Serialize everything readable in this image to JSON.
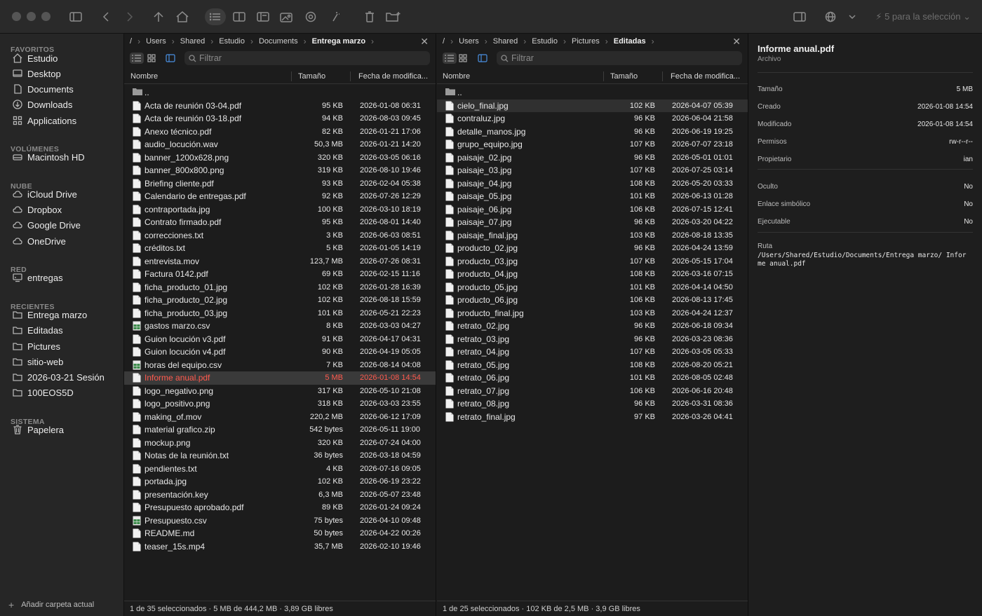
{
  "toolbar": {
    "selection_label": "5 para la selección"
  },
  "sidebar": {
    "sections": [
      {
        "title": "FAVORITOS",
        "items": [
          {
            "label": "Estudio",
            "icon": "home-icon"
          },
          {
            "label": "Desktop",
            "icon": "desktop-icon"
          },
          {
            "label": "Documents",
            "icon": "document-icon"
          },
          {
            "label": "Downloads",
            "icon": "download-icon"
          },
          {
            "label": "Applications",
            "icon": "apps-icon"
          }
        ]
      },
      {
        "title": "VOLÚMENES",
        "items": [
          {
            "label": "Macintosh HD",
            "icon": "drive-icon"
          }
        ]
      },
      {
        "title": "NUBE",
        "items": [
          {
            "label": "iCloud Drive",
            "icon": "cloud-icon"
          },
          {
            "label": "Dropbox",
            "icon": "cloud-icon"
          },
          {
            "label": "Google Drive",
            "icon": "cloud-icon"
          },
          {
            "label": "OneDrive",
            "icon": "cloud-icon"
          }
        ]
      },
      {
        "title": "RED",
        "items": [
          {
            "label": "entregas",
            "icon": "network-drive-icon"
          }
        ]
      },
      {
        "title": "RECIENTES",
        "items": [
          {
            "label": "Entrega marzo",
            "icon": "folder-icon"
          },
          {
            "label": "Editadas",
            "icon": "folder-icon"
          },
          {
            "label": "Pictures",
            "icon": "folder-icon"
          },
          {
            "label": "sitio-web",
            "icon": "folder-icon"
          },
          {
            "label": "2026-03-21 Sesión",
            "icon": "folder-icon"
          },
          {
            "label": "100EOS5D",
            "icon": "folder-icon"
          }
        ]
      },
      {
        "title": "SISTEMA",
        "items": [
          {
            "label": "Papelera",
            "icon": "trash-icon"
          }
        ]
      }
    ],
    "footer_label": "Añadir carpeta actual"
  },
  "left_pane": {
    "breadcrumb": [
      "/",
      "Users",
      "Shared",
      "Estudio",
      "Documents",
      "Entrega marzo"
    ],
    "filter_placeholder": "Filtrar",
    "columns": {
      "name": "Nombre",
      "size": "Tamaño",
      "date": "Fecha de modifica..."
    },
    "parent": "..",
    "files": [
      {
        "name": "Acta de reunión 03-04.pdf",
        "size": "95 KB",
        "date": "2026-01-08 06:31"
      },
      {
        "name": "Acta de reunión 03-18.pdf",
        "size": "94 KB",
        "date": "2026-08-03 09:45"
      },
      {
        "name": "Anexo técnico.pdf",
        "size": "82 KB",
        "date": "2026-01-21 17:06"
      },
      {
        "name": "audio_locución.wav",
        "size": "50,3 MB",
        "date": "2026-01-21 14:20"
      },
      {
        "name": "banner_1200x628.png",
        "size": "320 KB",
        "date": "2026-03-05 06:16"
      },
      {
        "name": "banner_800x800.png",
        "size": "319 KB",
        "date": "2026-08-10 19:46"
      },
      {
        "name": "Briefing cliente.pdf",
        "size": "93 KB",
        "date": "2026-02-04 05:38"
      },
      {
        "name": "Calendario de entregas.pdf",
        "size": "92 KB",
        "date": "2026-07-26 12:29"
      },
      {
        "name": "contraportada.jpg",
        "size": "100 KB",
        "date": "2026-03-10 18:19"
      },
      {
        "name": "Contrato firmado.pdf",
        "size": "95 KB",
        "date": "2026-08-01 14:40"
      },
      {
        "name": "correcciones.txt",
        "size": "3 KB",
        "date": "2026-06-03 08:51"
      },
      {
        "name": "créditos.txt",
        "size": "5 KB",
        "date": "2026-01-05 14:19"
      },
      {
        "name": "entrevista.mov",
        "size": "123,7 MB",
        "date": "2026-07-26 08:31"
      },
      {
        "name": "Factura 0142.pdf",
        "size": "69 KB",
        "date": "2026-02-15 11:16"
      },
      {
        "name": "ficha_producto_01.jpg",
        "size": "102 KB",
        "date": "2026-01-28 16:39"
      },
      {
        "name": "ficha_producto_02.jpg",
        "size": "102 KB",
        "date": "2026-08-18 15:59"
      },
      {
        "name": "ficha_producto_03.jpg",
        "size": "101 KB",
        "date": "2026-05-21 22:23"
      },
      {
        "name": "gastos marzo.csv",
        "size": "8 KB",
        "date": "2026-03-03 04:27",
        "icon": "spreadsheet-icon"
      },
      {
        "name": "Guion locución v3.pdf",
        "size": "91 KB",
        "date": "2026-04-17 04:31"
      },
      {
        "name": "Guion locución v4.pdf",
        "size": "90 KB",
        "date": "2026-04-19 05:05"
      },
      {
        "name": "horas del equipo.csv",
        "size": "7 KB",
        "date": "2026-08-14 04:08",
        "icon": "spreadsheet-icon"
      },
      {
        "name": "Informe anual.pdf",
        "size": "5 MB",
        "date": "2026-01-08 14:54",
        "highlight": true
      },
      {
        "name": "logo_negativo.png",
        "size": "317 KB",
        "date": "2026-05-10 21:08"
      },
      {
        "name": "logo_positivo.png",
        "size": "318 KB",
        "date": "2026-03-03 23:55"
      },
      {
        "name": "making_of.mov",
        "size": "220,2 MB",
        "date": "2026-06-12 17:09"
      },
      {
        "name": "material grafico.zip",
        "size": "542 bytes",
        "date": "2026-05-11 19:00"
      },
      {
        "name": "mockup.png",
        "size": "320 KB",
        "date": "2026-07-24 04:00"
      },
      {
        "name": "Notas de la reunión.txt",
        "size": "36 bytes",
        "date": "2026-03-18 04:59"
      },
      {
        "name": "pendientes.txt",
        "size": "4 KB",
        "date": "2026-07-16 09:05"
      },
      {
        "name": "portada.jpg",
        "size": "102 KB",
        "date": "2026-06-19 23:22"
      },
      {
        "name": "presentación.key",
        "size": "6,3 MB",
        "date": "2026-05-07 23:48"
      },
      {
        "name": "Presupuesto aprobado.pdf",
        "size": "89 KB",
        "date": "2026-01-24 09:24"
      },
      {
        "name": "Presupuesto.csv",
        "size": "75 bytes",
        "date": "2026-04-10 09:48",
        "icon": "spreadsheet-icon"
      },
      {
        "name": "README.md",
        "size": "50 bytes",
        "date": "2026-04-22 00:26"
      },
      {
        "name": "teaser_15s.mp4",
        "size": "35,7 MB",
        "date": "2026-02-10 19:46"
      }
    ],
    "status": "1 de 35 seleccionados · 5 MB de 444,2 MB · 3,89 GB libres"
  },
  "right_pane": {
    "breadcrumb": [
      "/",
      "Users",
      "Shared",
      "Estudio",
      "Pictures",
      "Editadas"
    ],
    "filter_placeholder": "Filtrar",
    "columns": {
      "name": "Nombre",
      "size": "Tamaño",
      "date": "Fecha de modifica..."
    },
    "parent": "..",
    "files": [
      {
        "name": "cielo_final.jpg",
        "size": "102 KB",
        "date": "2026-04-07 05:39",
        "selected": true
      },
      {
        "name": "contraluz.jpg",
        "size": "96 KB",
        "date": "2026-06-04 21:58"
      },
      {
        "name": "detalle_manos.jpg",
        "size": "96 KB",
        "date": "2026-06-19 19:25"
      },
      {
        "name": "grupo_equipo.jpg",
        "size": "107 KB",
        "date": "2026-07-07 23:18"
      },
      {
        "name": "paisaje_02.jpg",
        "size": "96 KB",
        "date": "2026-05-01 01:01"
      },
      {
        "name": "paisaje_03.jpg",
        "size": "107 KB",
        "date": "2026-07-25 03:14"
      },
      {
        "name": "paisaje_04.jpg",
        "size": "108 KB",
        "date": "2026-05-20 03:33"
      },
      {
        "name": "paisaje_05.jpg",
        "size": "101 KB",
        "date": "2026-06-13 01:28"
      },
      {
        "name": "paisaje_06.jpg",
        "size": "106 KB",
        "date": "2026-07-15 12:41"
      },
      {
        "name": "paisaje_07.jpg",
        "size": "96 KB",
        "date": "2026-03-20 04:22"
      },
      {
        "name": "paisaje_final.jpg",
        "size": "103 KB",
        "date": "2026-08-18 13:35"
      },
      {
        "name": "producto_02.jpg",
        "size": "96 KB",
        "date": "2026-04-24 13:59"
      },
      {
        "name": "producto_03.jpg",
        "size": "107 KB",
        "date": "2026-05-15 17:04"
      },
      {
        "name": "producto_04.jpg",
        "size": "108 KB",
        "date": "2026-03-16 07:15"
      },
      {
        "name": "producto_05.jpg",
        "size": "101 KB",
        "date": "2026-04-14 04:50"
      },
      {
        "name": "producto_06.jpg",
        "size": "106 KB",
        "date": "2026-08-13 17:45"
      },
      {
        "name": "producto_final.jpg",
        "size": "103 KB",
        "date": "2026-04-24 12:37"
      },
      {
        "name": "retrato_02.jpg",
        "size": "96 KB",
        "date": "2026-06-18 09:34"
      },
      {
        "name": "retrato_03.jpg",
        "size": "96 KB",
        "date": "2026-03-23 08:36"
      },
      {
        "name": "retrato_04.jpg",
        "size": "107 KB",
        "date": "2026-03-05 05:33"
      },
      {
        "name": "retrato_05.jpg",
        "size": "108 KB",
        "date": "2026-08-20 05:21"
      },
      {
        "name": "retrato_06.jpg",
        "size": "101 KB",
        "date": "2026-08-05 02:48"
      },
      {
        "name": "retrato_07.jpg",
        "size": "106 KB",
        "date": "2026-06-16 20:48"
      },
      {
        "name": "retrato_08.jpg",
        "size": "96 KB",
        "date": "2026-03-31 08:36"
      },
      {
        "name": "retrato_final.jpg",
        "size": "97 KB",
        "date": "2026-03-26 04:41"
      }
    ],
    "status": "1 de 25 seleccionados · 102 KB de 2,5 MB · 3,9 GB libres"
  },
  "info_panel": {
    "title": "Informe anual.pdf",
    "kind": "Archivo",
    "group1": [
      {
        "key": "Tamaño",
        "value": "5 MB"
      },
      {
        "key": "Creado",
        "value": "2026-01-08 14:54"
      },
      {
        "key": "Modificado",
        "value": "2026-01-08 14:54"
      },
      {
        "key": "Permisos",
        "value": "rw-r--r--"
      },
      {
        "key": "Propietario",
        "value": "ian"
      }
    ],
    "group2": [
      {
        "key": "Oculto",
        "value": "No"
      },
      {
        "key": "Enlace simbólico",
        "value": "No"
      },
      {
        "key": "Ejecutable",
        "value": "No"
      }
    ],
    "path_label": "Ruta",
    "path": "/Users/Shared/Estudio/Documents/Entrega marzo/ Informe anual.pdf"
  },
  "colors": {
    "highlight_text": "#ff5a4e",
    "selected_row": "#303030"
  }
}
